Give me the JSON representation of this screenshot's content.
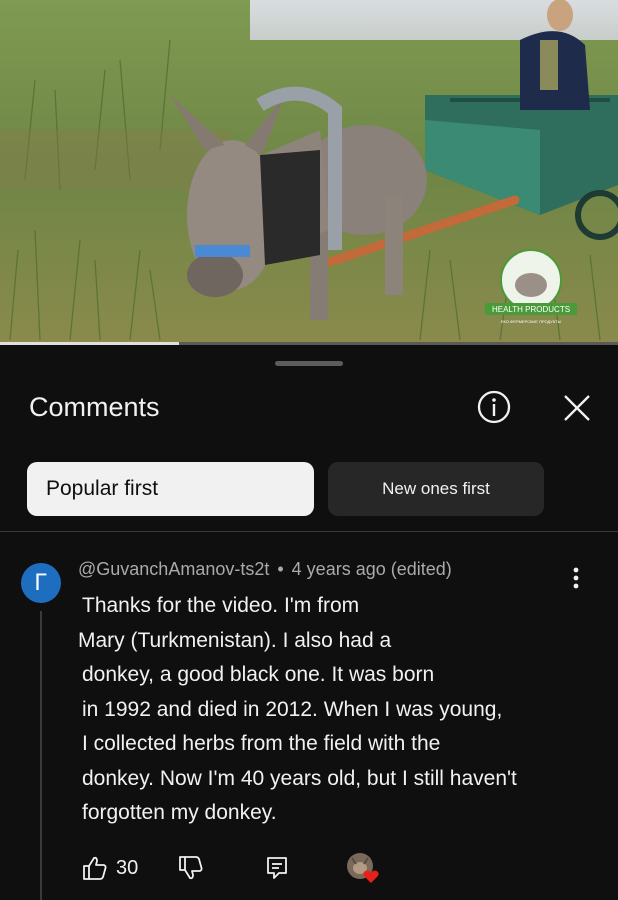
{
  "video": {
    "watermark_text": "HEALTH PRODUCTS",
    "watermark_subtext": "ЕКО-ФЕРМЕРСКИЕ ПРОДУКТЫ",
    "progress_fraction": 0.29
  },
  "comments_panel": {
    "title": "Comments",
    "info_icon": "info-circle-icon",
    "close_icon": "close-x-icon",
    "sort_chips": [
      {
        "label": "Popular first",
        "selected": true
      },
      {
        "label": "New ones first",
        "selected": false
      }
    ]
  },
  "comment": {
    "avatar_letter": "Г",
    "avatar_color": "#1e6ec0",
    "author": "@GuvanchAmanov-ts2t",
    "separator": "•",
    "time": "4 years ago (edited)",
    "lines": [
      "Thanks for the video. I'm from",
      "Mary (Turkmenistan). I also had a",
      "donkey, a good black one. It was born",
      "in 1992 and died in 2012. When I was young,",
      "I collected herbs from the field with the",
      "donkey. Now I'm 40 years old, but I still haven't",
      "forgotten my donkey."
    ],
    "likes": "30",
    "icons": {
      "like": "thumbs-up-icon",
      "dislike": "thumbs-down-icon",
      "reply": "reply-icon",
      "more": "more-vertical-icon",
      "creator_heart": "creator-heart-icon"
    }
  }
}
